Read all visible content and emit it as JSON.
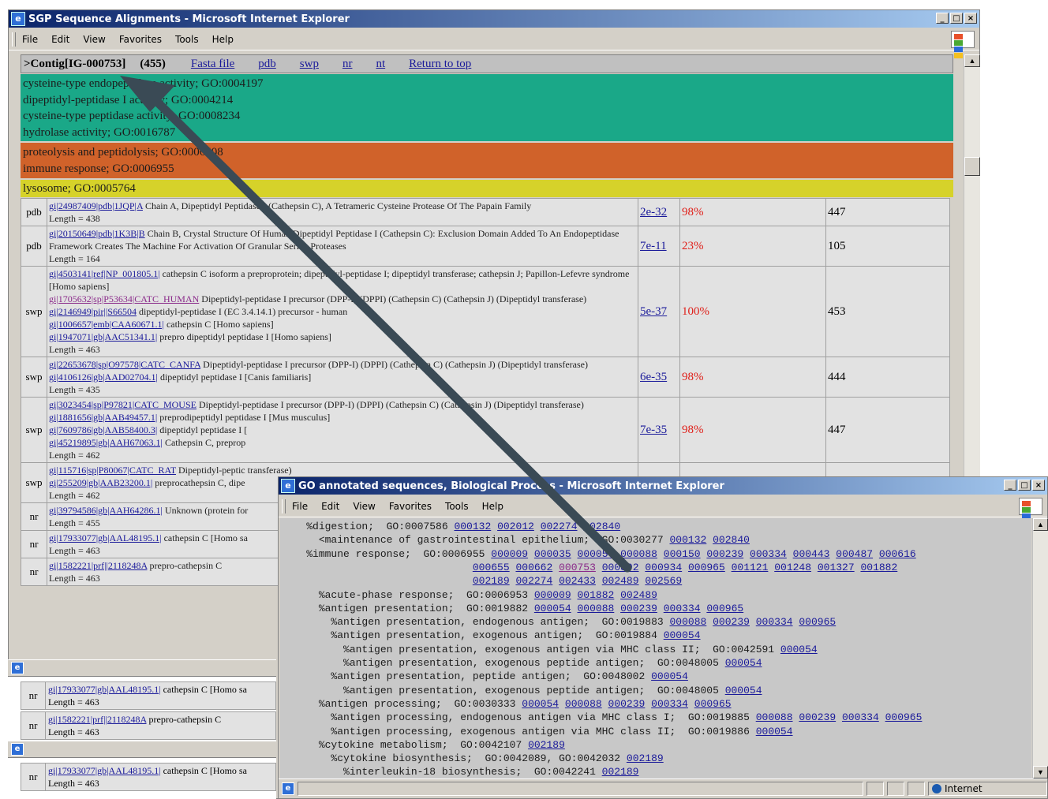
{
  "main_window": {
    "title": "SGP Sequence Alignments - Microsoft Internet Explorer",
    "menu": [
      "File",
      "Edit",
      "View",
      "Favorites",
      "Tools",
      "Help"
    ],
    "header": {
      "contig": ">Contig[IG-000753]",
      "count": "(455)",
      "links": [
        "Fasta file",
        "pdb",
        "swp",
        "nr",
        "nt",
        "Return to top"
      ]
    },
    "go_function": [
      "cysteine-type endopeptidase activity;   GO:0004197",
      "dipeptidyl-peptidase I activity;   GO:0004214",
      "cysteine-type peptidase activity;   GO:0008234",
      "hydrolase activity;   GO:0016787"
    ],
    "go_process": [
      "proteolysis and peptidolysis;   GO:0006508",
      "immune response;   GO:0006955"
    ],
    "go_component": [
      "lysosome;   GO:0005764"
    ],
    "hits": [
      {
        "source": "pdb",
        "lines": [
          {
            "link": "gi|24987409|pdb|1JQP|A",
            "text": " Chain A, Dipeptidyl Peptidase I (Cathepsin C), A Tetrameric Cysteine Protease Of The Papain Family"
          }
        ],
        "length": "Length = 438",
        "evalue": "2e-32",
        "percent": "98%",
        "len2": "447"
      },
      {
        "source": "pdb",
        "lines": [
          {
            "link": "gi|20150649|pdb|1K3B|B",
            "text": " Chain B, Crystal Structure Of Human Dipeptidyl Peptidase I (Cathepsin C): Exclusion Domain Added To An Endopeptidase Framework Creates The Machine For Activation Of Granular Serine Proteases"
          }
        ],
        "length": "Length = 164",
        "evalue": "7e-11",
        "percent": "23%",
        "len2": "105"
      },
      {
        "source": "swp",
        "lines": [
          {
            "link": "gi|4503141|ref|NP_001805.1|",
            "text": " cathepsin C isoform a preproprotein; dipeptidyl-peptidase I; dipeptidyl transferase; cathepsin J; Papillon-Lefevre syndrome [Homo sapiens]"
          },
          {
            "link": "gi|1705632|sp|P53634|CATC_HUMAN",
            "text": " Dipeptidyl-peptidase I precursor (DPP-I) (DPPI) (Cathepsin C) (Cathepsin J) (Dipeptidyl transferase)"
          },
          {
            "link": "gi|2146949|pir||S66504",
            "text": " dipeptidyl-peptidase I (EC 3.4.14.1) precursor - human"
          },
          {
            "link": "gi|1006657|emb|CAA60671.1|",
            "text": " cathepsin C [Homo sapiens]"
          },
          {
            "link": "gi|1947071|gb|AAC51341.1|",
            "text": " prepro dipeptidyl peptidase I [Homo sapiens]"
          }
        ],
        "length": "Length = 463",
        "evalue": "5e-37",
        "percent": "100%",
        "len2": "453"
      },
      {
        "source": "swp",
        "lines": [
          {
            "link": "gi|22653678|sp|O97578|CATC_CANFA",
            "text": " Dipeptidyl-peptidase I precursor (DPP-I) (DPPI) (Cathepsin C) (Cathepsin J) (Dipeptidyl transferase)"
          },
          {
            "link": "gi|4106126|gb|AAD02704.1|",
            "text": " dipeptidyl peptidase I [Canis familiaris]"
          }
        ],
        "length": "Length = 435",
        "evalue": "6e-35",
        "percent": "98%",
        "len2": "444"
      },
      {
        "source": "swp",
        "lines": [
          {
            "link": "gi|3023454|sp|P97821|CATC_MOUSE",
            "text": " Dipeptidyl-peptidase I precursor (DPP-I) (DPPI) (Cathepsin C) (Cathepsin J) (Dipeptidyl transferase)"
          },
          {
            "link": "gi|1881656|gb|AAB49457.1|",
            "text": " preprodipeptidyl peptidase I [Mus musculus]"
          },
          {
            "link": "gi|7609786|gb|AAB58400.3|",
            "text": " dipeptidyl peptidase I ["
          },
          {
            "link": "gi|45219895|gb|AAH67063.1|",
            "text": " Cathepsin C, preprop"
          }
        ],
        "length": "Length = 462",
        "evalue": "7e-35",
        "percent": "98%",
        "len2": "447"
      },
      {
        "source": "swp",
        "lines": [
          {
            "link": "gi|115716|sp|P80067|CATC_RAT",
            "text": " Dipeptidyl-peptic transferase)"
          },
          {
            "link": "gi|255209|gb|AAB23200.1|",
            "text": " preprocathepsin C, dipe"
          }
        ],
        "length": "Length = 462",
        "evalue": "",
        "percent": "",
        "len2": ""
      },
      {
        "source": "nr",
        "lines": [
          {
            "link": "gi|39794586|gb|AAH64286.1|",
            "text": " Unknown (protein for"
          }
        ],
        "length": "Length = 455",
        "evalue": "",
        "percent": "",
        "len2": ""
      },
      {
        "source": "nr",
        "lines": [
          {
            "link": "gi|17933077|gb|AAL48195.1|",
            "text": " cathepsin C [Homo sa"
          }
        ],
        "length": "Length = 463",
        "evalue": "",
        "percent": "",
        "len2": ""
      },
      {
        "source": "nr",
        "lines": [
          {
            "link": "gi|1582221|prf||2118248A",
            "text": " prepro-cathepsin C"
          }
        ],
        "length": "Length = 463",
        "evalue": "",
        "percent": "",
        "len2": ""
      }
    ],
    "stack_rows": [
      {
        "source": "nr",
        "link": "gi|17933077|gb|AAL48195.1|",
        "text": " cathepsin C [Homo sa",
        "length": "Length = 463"
      },
      {
        "source": "nr",
        "link": "gi|1582221|prf||2118248A",
        "text": " prepro-cathepsin C",
        "length": "Length = 463"
      },
      {
        "source": "nr",
        "link": "gi|17933077|gb|AAL48195.1|",
        "text": " cathepsin C [Homo sa",
        "length": "Length = 463"
      }
    ]
  },
  "go_window": {
    "title": "GO annotated sequences, Biological Process - Microsoft Internet Explorer",
    "menu": [
      "File",
      "Edit",
      "View",
      "Favorites",
      "Tools",
      "Help"
    ],
    "status": "Internet",
    "lines": [
      {
        "indent": "    ",
        "text": "%digestion;  GO:0007586 ",
        "ids": [
          "000132",
          "002012",
          "002274",
          "002840"
        ]
      },
      {
        "indent": "      ",
        "text": "<maintenance of gastrointestinal epithelium;  GO:0030277 ",
        "ids": [
          "000132",
          "002840"
        ]
      },
      {
        "indent": "    ",
        "text": "%immune response;  GO:0006955 ",
        "ids": [
          "000009",
          "000035",
          "000054",
          "000088",
          "000150",
          "000239",
          "000334",
          "000443",
          "000487",
          "000616"
        ]
      },
      {
        "indent": "                               ",
        "text": "",
        "ids": [
          "000655",
          "000662",
          "000753",
          "000802",
          "000934",
          "000965",
          "001121",
          "001248",
          "001327",
          "001882"
        ]
      },
      {
        "indent": "                               ",
        "text": "",
        "ids": [
          "002189",
          "002274",
          "002433",
          "002489",
          "002569"
        ]
      },
      {
        "indent": "      ",
        "text": "%acute-phase response;  GO:0006953 ",
        "ids": [
          "000009",
          "001882",
          "002489"
        ]
      },
      {
        "indent": "      ",
        "text": "%antigen presentation;  GO:0019882 ",
        "ids": [
          "000054",
          "000088",
          "000239",
          "000334",
          "000965"
        ]
      },
      {
        "indent": "        ",
        "text": "%antigen presentation, endogenous antigen;  GO:0019883 ",
        "ids": [
          "000088",
          "000239",
          "000334",
          "000965"
        ]
      },
      {
        "indent": "        ",
        "text": "%antigen presentation, exogenous antigen;  GO:0019884 ",
        "ids": [
          "000054"
        ]
      },
      {
        "indent": "          ",
        "text": "%antigen presentation, exogenous antigen via MHC class II;  GO:0042591 ",
        "ids": [
          "000054"
        ]
      },
      {
        "indent": "          ",
        "text": "%antigen presentation, exogenous peptide antigen;  GO:0048005 ",
        "ids": [
          "000054"
        ]
      },
      {
        "indent": "        ",
        "text": "%antigen presentation, peptide antigen;  GO:0048002 ",
        "ids": [
          "000054"
        ]
      },
      {
        "indent": "          ",
        "text": "%antigen presentation, exogenous peptide antigen;  GO:0048005 ",
        "ids": [
          "000054"
        ]
      },
      {
        "indent": "      ",
        "text": "%antigen processing;  GO:0030333 ",
        "ids": [
          "000054",
          "000088",
          "000239",
          "000334",
          "000965"
        ]
      },
      {
        "indent": "        ",
        "text": "%antigen processing, endogenous antigen via MHC class I;  GO:0019885 ",
        "ids": [
          "000088",
          "000239",
          "000334",
          "000965"
        ]
      },
      {
        "indent": "        ",
        "text": "%antigen processing, exogenous antigen via MHC class II;  GO:0019886 ",
        "ids": [
          "000054"
        ]
      },
      {
        "indent": "      ",
        "text": "%cytokine metabolism;  GO:0042107 ",
        "ids": [
          "002189"
        ]
      },
      {
        "indent": "        ",
        "text": "%cytokine biosynthesis;  GO:0042089, GO:0042032 ",
        "ids": [
          "002189"
        ]
      },
      {
        "indent": "          ",
        "text": "%interleukin-18 biosynthesis;  GO:0042241 ",
        "ids": [
          "002189"
        ]
      }
    ],
    "visited_id": "000753"
  },
  "colors": {
    "teal": "#1aa888",
    "orange": "#d0622a",
    "yellow": "#d6d22a",
    "arrow": "#3a4a55"
  }
}
